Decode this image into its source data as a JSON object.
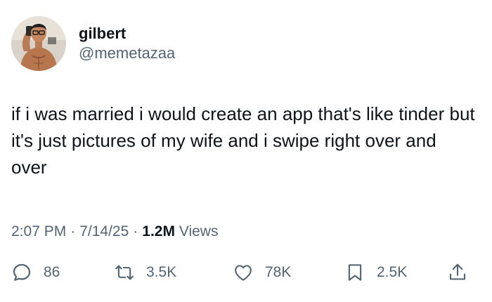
{
  "author": {
    "display_name": "gilbert",
    "handle": "@memetazaa"
  },
  "tweet": {
    "text": "if i was married i would create an app that's like tinder but it's just pictures of my wife and i swipe right over and over"
  },
  "meta": {
    "time": "2:07 PM",
    "separator": "·",
    "date": "7/14/25",
    "views_count": "1.2M",
    "views_label": "Views"
  },
  "actions": {
    "replies": "86",
    "retweets": "3.5K",
    "likes": "78K",
    "bookmarks": "2.5K"
  },
  "icons": {
    "reply": "reply-icon",
    "retweet": "retweet-icon",
    "like": "heart-icon",
    "bookmark": "bookmark-icon",
    "share": "share-icon"
  },
  "colors": {
    "text_primary": "#0f1419",
    "text_secondary": "#536471"
  }
}
